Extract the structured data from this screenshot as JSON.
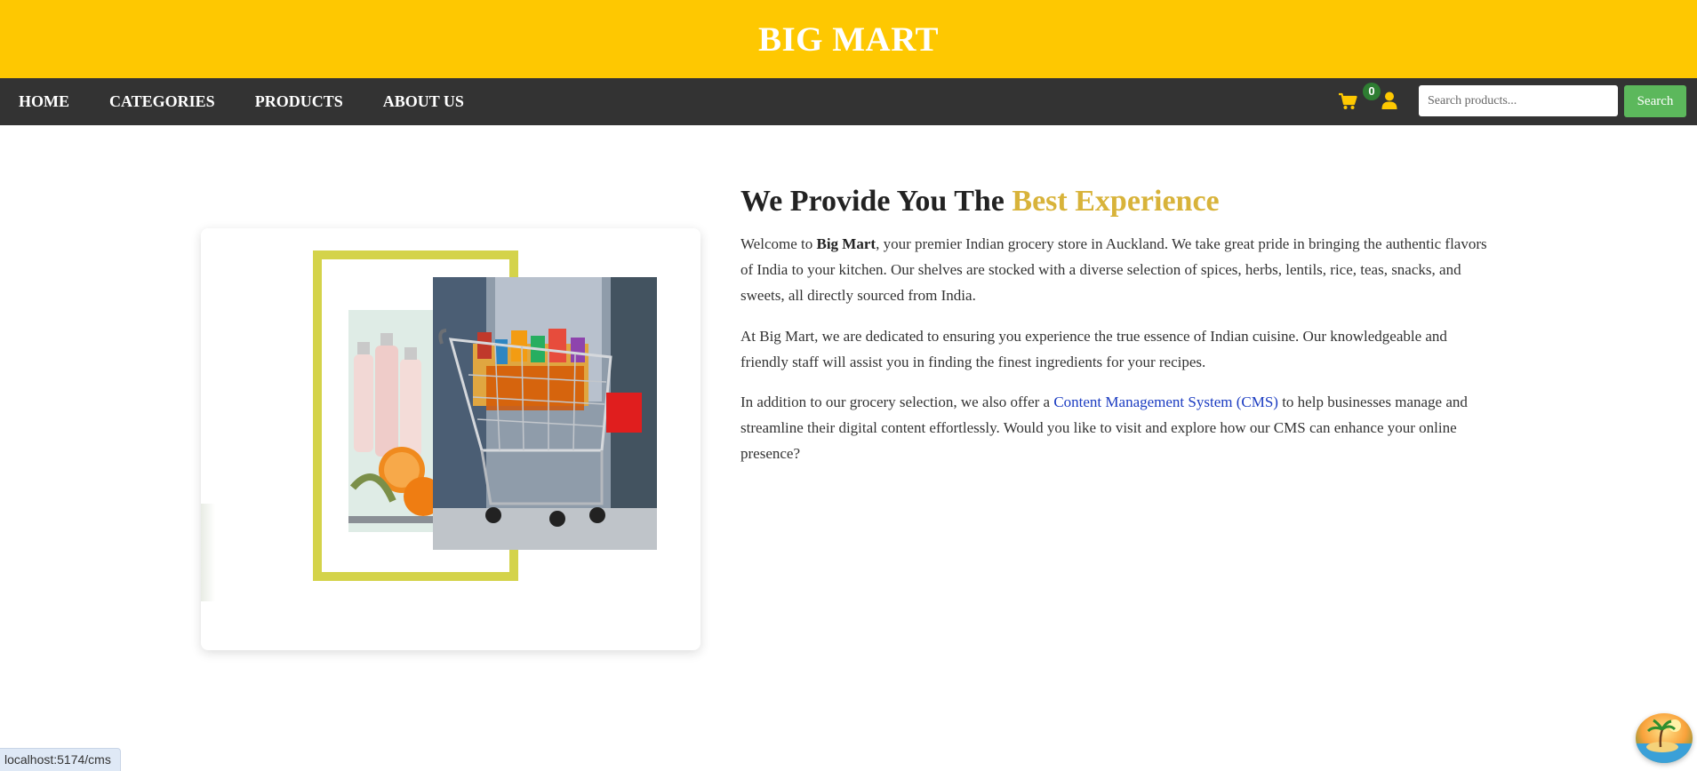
{
  "header": {
    "brand": "BIG MART",
    "brand_color": "#fec801"
  },
  "nav": {
    "links": [
      "HOME",
      "CATEGORIES",
      "PRODUCTS",
      "ABOUT US"
    ],
    "cart_count": "0",
    "icons": [
      "shopping-cart-icon",
      "user-icon"
    ],
    "search": {
      "placeholder": "Search products...",
      "value": "",
      "button_label": "Search"
    }
  },
  "about": {
    "title_main": "We Provide You The ",
    "title_accent": "Best Experience",
    "accent_color": "#d8b33a",
    "p1_intro": "Welcome to ",
    "p1_brand": "Big Mart",
    "p1_rest": ", your premier Indian grocery store in Auckland. We take great pride in bringing the authentic flavors of India to your kitchen. Our shelves are stocked with a diverse selection of spices, herbs, lentils, rice, teas, snacks, and sweets, all directly sourced from India.",
    "p2": "At Big Mart, we are dedicated to ensuring you experience the true essence of Indian cuisine. Our knowledgeable and friendly staff will assist you in finding the finest ingredients for your recipes.",
    "p3_intro": "In addition to our grocery selection, we also offer a ",
    "p3_link": "Content Management System (CMS)",
    "p3_rest": " to help businesses manage and streamline their digital content effortlessly. Would you like to visit and explore how our CMS can enhance your online presence?"
  },
  "status_bar": {
    "url": "localhost:5174/cms"
  }
}
